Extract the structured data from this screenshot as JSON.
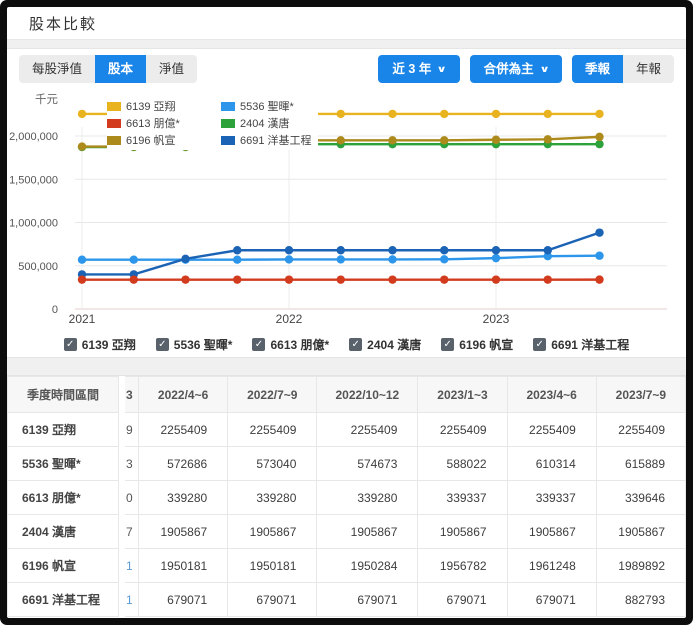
{
  "page": {
    "title": "股本比較"
  },
  "icons": {
    "chevron": "∨",
    "check": "✓"
  },
  "colors": {
    "accent_blue": "#1a85e8",
    "series": {
      "6139": "#e8b31e",
      "5536": "#2d96ea",
      "6613": "#d23b1e",
      "2404": "#2da23a",
      "6196": "#ad8a1c",
      "6691": "#1b63b5"
    }
  },
  "toolbar": {
    "left_tabs": [
      {
        "label": "每股淨值",
        "active": false
      },
      {
        "label": "股本",
        "active": true
      },
      {
        "label": "淨值",
        "active": false
      }
    ],
    "range_dropdown": "近 3 年",
    "basis_dropdown": "合併為主",
    "period_tabs": [
      {
        "label": "季報",
        "active": true
      },
      {
        "label": "年報",
        "active": false
      }
    ]
  },
  "chart": {
    "unit_label": "千元",
    "legend": [
      {
        "code": "6139",
        "name": "6139 亞翔"
      },
      {
        "code": "5536",
        "name": "5536 聖暉*"
      },
      {
        "code": "6613",
        "name": "6613 朋億*"
      },
      {
        "code": "2404",
        "name": "2404 漢唐"
      },
      {
        "code": "6196",
        "name": "6196 帆宣"
      },
      {
        "code": "6691",
        "name": "6691 洋基工程"
      }
    ]
  },
  "chart_data": {
    "type": "line",
    "title": "股本比較 (千元)",
    "x": [
      "2021Q1",
      "2021Q2",
      "2021Q3",
      "2021Q4",
      "2022Q1",
      "2022Q2",
      "2022Q3",
      "2022Q4",
      "2023Q1",
      "2023Q2",
      "2023Q3"
    ],
    "x_tick_labels": [
      {
        "label": "2021",
        "index": 0
      },
      {
        "label": "2022",
        "index": 4
      },
      {
        "label": "2023",
        "index": 8
      }
    ],
    "y_ticks": [
      0,
      500000,
      1000000,
      1500000,
      2000000
    ],
    "y_tick_labels": [
      "0",
      "500,000",
      "1,000,000",
      "1,500,000",
      "2,000,000"
    ],
    "ylim": [
      0,
      2400000
    ],
    "ylabel": "千元",
    "grid": true,
    "legend_position": "top-left-overlay",
    "series": [
      {
        "code": "6139",
        "name": "6139 亞翔",
        "values": [
          2255409,
          2255409,
          2255409,
          2255409,
          2255409,
          2255409,
          2255409,
          2255409,
          2255409,
          2255409,
          2255409
        ]
      },
      {
        "code": "5536",
        "name": "5536 聖暉*",
        "values": [
          570000,
          570000,
          570000,
          570000,
          572686,
          572686,
          573040,
          574673,
          588022,
          610314,
          615889
        ]
      },
      {
        "code": "6613",
        "name": "6613 朋億*",
        "values": [
          339280,
          339280,
          339280,
          339280,
          339280,
          339280,
          339280,
          339280,
          339337,
          339337,
          339646
        ]
      },
      {
        "code": "2404",
        "name": "2404 漢唐",
        "values": [
          1872000,
          1872000,
          1872000,
          1905867,
          1905867,
          1905867,
          1905867,
          1905867,
          1905867,
          1905867,
          1905867
        ]
      },
      {
        "code": "6196",
        "name": "6196 帆宣",
        "values": [
          1878000,
          1878000,
          1878000,
          1932000,
          1950181,
          1950181,
          1950181,
          1950284,
          1956782,
          1961248,
          1989892
        ]
      },
      {
        "code": "6691",
        "name": "6691 洋基工程",
        "values": [
          400000,
          400000,
          580000,
          679071,
          679071,
          679071,
          679071,
          679071,
          679071,
          679071,
          882793
        ]
      }
    ]
  },
  "checkboxes": [
    {
      "code": "6139",
      "label": "6139 亞翔",
      "checked": true
    },
    {
      "code": "5536",
      "label": "5536 聖暉*",
      "checked": true
    },
    {
      "code": "6613",
      "label": "6613 朋億*",
      "checked": true
    },
    {
      "code": "2404",
      "label": "2404 漢唐",
      "checked": true
    },
    {
      "code": "6196",
      "label": "6196 帆宣",
      "checked": true
    },
    {
      "code": "6691",
      "label": "6691 洋基工程",
      "checked": true
    }
  ],
  "table": {
    "header_col": "季度時間區間",
    "clipped": {
      "header": "3",
      "cells": [
        "9",
        "3",
        "0",
        "7",
        "1",
        "1"
      ],
      "blue": [
        false,
        false,
        false,
        false,
        true,
        true
      ]
    },
    "columns": [
      "2022/4~6",
      "2022/7~9",
      "2022/10~12",
      "2023/1~3",
      "2023/4~6",
      "2023/7~9"
    ],
    "rows": [
      {
        "label": "6139 亞翔",
        "values": [
          "2255409",
          "2255409",
          "2255409",
          "2255409",
          "2255409",
          "2255409"
        ]
      },
      {
        "label": "5536 聖暉*",
        "values": [
          "572686",
          "573040",
          "574673",
          "588022",
          "610314",
          "615889"
        ]
      },
      {
        "label": "6613 朋億*",
        "values": [
          "339280",
          "339280",
          "339280",
          "339337",
          "339337",
          "339646"
        ]
      },
      {
        "label": "2404 漢唐",
        "values": [
          "1905867",
          "1905867",
          "1905867",
          "1905867",
          "1905867",
          "1905867"
        ]
      },
      {
        "label": "6196 帆宣",
        "values": [
          "1950181",
          "1950181",
          "1950284",
          "1956782",
          "1961248",
          "1989892"
        ]
      },
      {
        "label": "6691 洋基工程",
        "values": [
          "679071",
          "679071",
          "679071",
          "679071",
          "679071",
          "882793"
        ]
      }
    ]
  }
}
